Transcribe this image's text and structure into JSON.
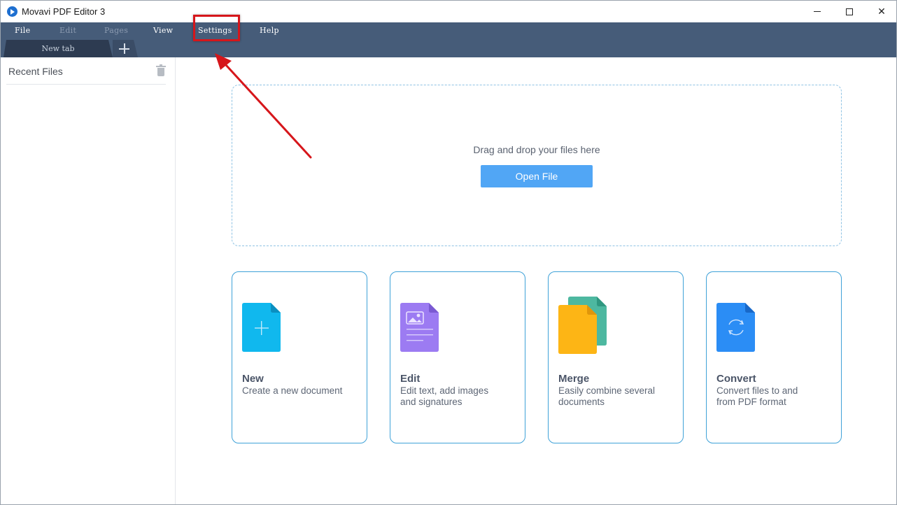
{
  "window": {
    "title": "Movavi PDF Editor 3"
  },
  "menu": {
    "file": "File",
    "edit": "Edit",
    "pages": "Pages",
    "view": "View",
    "settings": "Settings",
    "help": "Help"
  },
  "tabs": [
    {
      "label": "New tab"
    }
  ],
  "sidebar": {
    "title": "Recent Files"
  },
  "dropzone": {
    "text": "Drag and drop your files here",
    "open_button": "Open File"
  },
  "cards": [
    {
      "title": "New",
      "line1": "Create a new document",
      "line2": "",
      "icon": "new-document-icon",
      "color": "#10b8ee"
    },
    {
      "title": "Edit",
      "line1": "Edit text, add images",
      "line2": "and signatures",
      "icon": "edit-document-icon",
      "color": "#9c7bf2"
    },
    {
      "title": "Merge",
      "line1": "Easily combine several",
      "line2": "documents",
      "icon": "merge-documents-icon",
      "color": "#fdb515"
    },
    {
      "title": "Convert",
      "line1": "Convert files to and",
      "line2": "from PDF format",
      "icon": "convert-document-icon",
      "color": "#2b8df5"
    }
  ],
  "colors": {
    "menubar": "#465c79",
    "accent": "#51a6f5",
    "card_border": "#3fa2d8",
    "highlight": "#d6161b"
  }
}
